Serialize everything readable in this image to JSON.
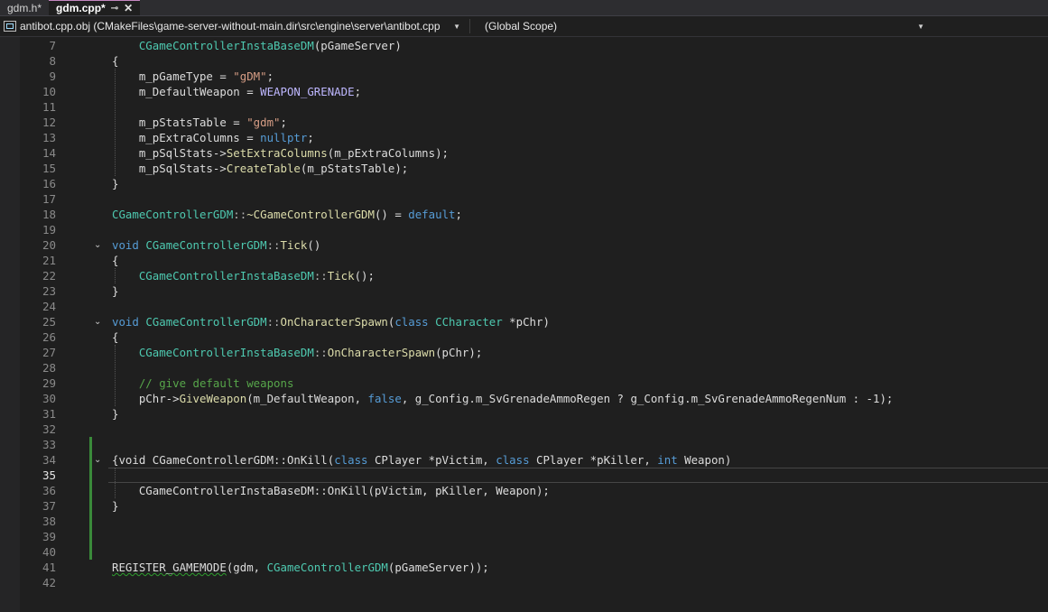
{
  "tabs": [
    {
      "label": "gdm.h*",
      "active": false
    },
    {
      "label": "gdm.cpp*",
      "active": true,
      "pin": "⊸",
      "close": "✕"
    }
  ],
  "navbar": {
    "project": "antibot.cpp.obj (CMakeFiles\\game-server-without-main.dir\\src\\engine\\server\\antibot.cpp",
    "scope": "(Global Scope)"
  },
  "editor": {
    "current_line": 35,
    "lines": [
      {
        "n": "7",
        "tokens": [
          [
            "    ",
            "plain"
          ],
          [
            "CGameControllerInstaBaseDM",
            "type"
          ],
          [
            "(pGameServer)",
            "plain"
          ]
        ]
      },
      {
        "n": "8",
        "tokens": [
          [
            "{",
            "plain"
          ]
        ]
      },
      {
        "n": "9",
        "tokens": [
          [
            "    m_pGameType = ",
            "plain"
          ],
          [
            "\"gDM\"",
            "str"
          ],
          [
            ";",
            "plain"
          ]
        ]
      },
      {
        "n": "10",
        "tokens": [
          [
            "    m_DefaultWeapon = ",
            "plain"
          ],
          [
            "WEAPON_GRENADE",
            "mac"
          ],
          [
            ";",
            "plain"
          ]
        ]
      },
      {
        "n": "11",
        "tokens": [
          [
            "",
            "plain"
          ]
        ]
      },
      {
        "n": "12",
        "tokens": [
          [
            "    m_pStatsTable = ",
            "plain"
          ],
          [
            "\"gdm\"",
            "str"
          ],
          [
            ";",
            "plain"
          ]
        ]
      },
      {
        "n": "13",
        "tokens": [
          [
            "    m_pExtraColumns = ",
            "plain"
          ],
          [
            "nullptr",
            "kw"
          ],
          [
            ";",
            "plain"
          ]
        ]
      },
      {
        "n": "14",
        "tokens": [
          [
            "    m_pSqlStats->",
            "plain"
          ],
          [
            "SetExtraColumns",
            "fn"
          ],
          [
            "(m_pExtraColumns);",
            "plain"
          ]
        ]
      },
      {
        "n": "15",
        "tokens": [
          [
            "    m_pSqlStats->",
            "plain"
          ],
          [
            "CreateTable",
            "fn"
          ],
          [
            "(m_pStatsTable);",
            "plain"
          ]
        ]
      },
      {
        "n": "16",
        "tokens": [
          [
            "}",
            "plain"
          ]
        ]
      },
      {
        "n": "17",
        "tokens": [
          [
            "",
            "plain"
          ]
        ]
      },
      {
        "n": "18",
        "tokens": [
          [
            "CGameControllerGDM",
            "type"
          ],
          [
            "::",
            "op"
          ],
          [
            "~CGameControllerGDM",
            "fn"
          ],
          [
            "() = ",
            "plain"
          ],
          [
            "default",
            "kw"
          ],
          [
            ";",
            "plain"
          ]
        ]
      },
      {
        "n": "19",
        "tokens": [
          [
            "",
            "plain"
          ]
        ]
      },
      {
        "n": "20",
        "tokens": [
          [
            "void ",
            "kw"
          ],
          [
            "CGameControllerGDM",
            "type"
          ],
          [
            "::",
            "op"
          ],
          [
            "Tick",
            "fn"
          ],
          [
            "()",
            "plain"
          ]
        ]
      },
      {
        "n": "21",
        "tokens": [
          [
            "{",
            "plain"
          ]
        ]
      },
      {
        "n": "22",
        "tokens": [
          [
            "    ",
            "plain"
          ],
          [
            "CGameControllerInstaBaseDM",
            "type"
          ],
          [
            "::",
            "op"
          ],
          [
            "Tick",
            "fn"
          ],
          [
            "();",
            "plain"
          ]
        ]
      },
      {
        "n": "23",
        "tokens": [
          [
            "}",
            "plain"
          ]
        ]
      },
      {
        "n": "24",
        "tokens": [
          [
            "",
            "plain"
          ]
        ]
      },
      {
        "n": "25",
        "tokens": [
          [
            "void ",
            "kw"
          ],
          [
            "CGameControllerGDM",
            "type"
          ],
          [
            "::",
            "op"
          ],
          [
            "OnCharacterSpawn",
            "fn"
          ],
          [
            "(",
            "plain"
          ],
          [
            "class ",
            "kw"
          ],
          [
            "CCharacter",
            "type"
          ],
          [
            " *pChr)",
            "plain"
          ]
        ]
      },
      {
        "n": "26",
        "tokens": [
          [
            "{",
            "plain"
          ]
        ]
      },
      {
        "n": "27",
        "tokens": [
          [
            "    ",
            "plain"
          ],
          [
            "CGameControllerInstaBaseDM",
            "type"
          ],
          [
            "::",
            "op"
          ],
          [
            "OnCharacterSpawn",
            "fn"
          ],
          [
            "(pChr);",
            "plain"
          ]
        ]
      },
      {
        "n": "28",
        "tokens": [
          [
            "",
            "plain"
          ]
        ]
      },
      {
        "n": "29",
        "tokens": [
          [
            "    // give default weapons",
            "cm"
          ]
        ]
      },
      {
        "n": "30",
        "tokens": [
          [
            "    pChr->",
            "plain"
          ],
          [
            "GiveWeapon",
            "fn"
          ],
          [
            "(m_DefaultWeapon, ",
            "plain"
          ],
          [
            "false",
            "kw"
          ],
          [
            ", g_Config.m_SvGrenadeAmmoRegen ? g_Config.m_SvGrenadeAmmoRegenNum : -1);",
            "plain"
          ]
        ]
      },
      {
        "n": "31",
        "tokens": [
          [
            "}",
            "plain"
          ]
        ]
      },
      {
        "n": "32",
        "tokens": [
          [
            "",
            "plain"
          ]
        ]
      },
      {
        "n": "33",
        "tokens": [
          [
            "",
            "plain"
          ]
        ]
      },
      {
        "n": "34",
        "tokens": [
          [
            "{void CGameControllerGDM::OnKill(",
            "plain"
          ],
          [
            "class ",
            "kw"
          ],
          [
            "CPlayer *pVictim, ",
            "plain"
          ],
          [
            "class ",
            "kw"
          ],
          [
            "CPlayer *pKiller, ",
            "plain"
          ],
          [
            "int ",
            "kw"
          ],
          [
            "Weapon)",
            "plain"
          ]
        ]
      },
      {
        "n": "35",
        "tokens": [
          [
            "",
            "plain"
          ]
        ]
      },
      {
        "n": "36",
        "tokens": [
          [
            "    CGameControllerInstaBaseDM::OnKill(pVictim, pKiller, Weapon);",
            "plain"
          ]
        ]
      },
      {
        "n": "37",
        "tokens": [
          [
            "}",
            "plain"
          ]
        ]
      },
      {
        "n": "38",
        "tokens": [
          [
            "",
            "plain"
          ]
        ]
      },
      {
        "n": "39",
        "tokens": [
          [
            "",
            "plain"
          ]
        ]
      },
      {
        "n": "40",
        "tokens": [
          [
            "",
            "plain"
          ]
        ]
      },
      {
        "n": "41",
        "tokens": [
          [
            "REGISTER_GAMEMODE",
            "squig"
          ],
          [
            "(gdm, ",
            "plain"
          ],
          [
            "CGameControllerGDM",
            "type"
          ],
          [
            "(pGameServer));",
            "plain"
          ]
        ]
      },
      {
        "n": "42",
        "tokens": [
          [
            "",
            "plain"
          ]
        ]
      }
    ]
  },
  "colors": {
    "background": "#1f1f1f",
    "type": "#4ec9b0",
    "keyword": "#569cd6",
    "string": "#d69d85",
    "function": "#dcdcaa",
    "comment": "#57a64a",
    "macro": "#beb7ff"
  }
}
